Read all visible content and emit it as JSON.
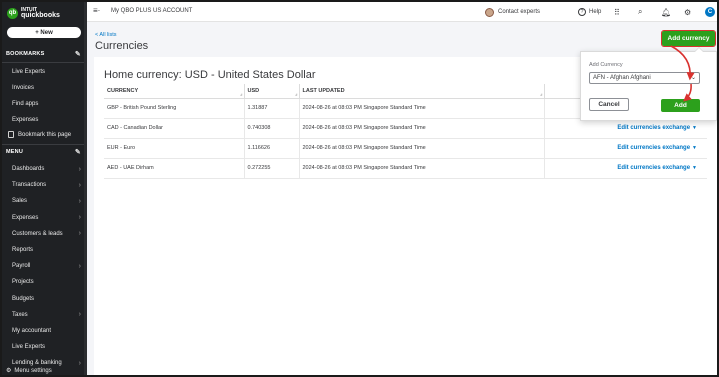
{
  "sidebar": {
    "logo_line1": "INTUIT",
    "logo_line2": "quickbooks",
    "new_label": "+ New",
    "bookmarks_title": "BOOKMARKS",
    "bookmarks": [
      "Live Experts",
      "Invoices",
      "Find apps",
      "Expenses"
    ],
    "bookmark_this_page": "Bookmark this page",
    "menu_title": "MENU",
    "menu_items": [
      {
        "label": "Dashboards",
        "chevron": true
      },
      {
        "label": "Transactions",
        "chevron": true
      },
      {
        "label": "Sales",
        "chevron": true
      },
      {
        "label": "Expenses",
        "chevron": true
      },
      {
        "label": "Customers & leads",
        "chevron": true
      },
      {
        "label": "Reports",
        "chevron": false
      },
      {
        "label": "Payroll",
        "chevron": true
      },
      {
        "label": "Projects",
        "chevron": false
      },
      {
        "label": "Budgets",
        "chevron": false
      },
      {
        "label": "Taxes",
        "chevron": true
      },
      {
        "label": "My accountant",
        "chevron": false
      },
      {
        "label": "Live Experts",
        "chevron": false
      },
      {
        "label": "Lending & banking",
        "chevron": true
      }
    ],
    "menu_settings": "Menu settings"
  },
  "topbar": {
    "company": "My QBO PLUS US ACCOUNT",
    "contact_experts": "Contact experts",
    "help": "Help",
    "user_initial": "C"
  },
  "header": {
    "back_link": "< All lists",
    "title": "Currencies"
  },
  "main": {
    "home_currency": "Home currency: USD - United States Dollar",
    "add_currency_label": "Add currency",
    "table": {
      "headers": [
        "CURRENCY",
        "USD",
        "LAST UPDATED",
        ""
      ],
      "rows": [
        {
          "currency": "GBP - British Pound Sterling",
          "usd": "1.31887",
          "updated": "2024-08-26 at 08:03 PM Singapore Standard Time",
          "action": ""
        },
        {
          "currency": "CAD - Canadian Dollar",
          "usd": "0.740308",
          "updated": "2024-08-26 at 08:03 PM Singapore Standard Time",
          "action": "Edit currencies exchange"
        },
        {
          "currency": "EUR - Euro",
          "usd": "1.116626",
          "updated": "2024-08-26 at 08:03 PM Singapore Standard Time",
          "action": "Edit currencies exchange"
        },
        {
          "currency": "AED - UAE Dirham",
          "usd": "0.272255",
          "updated": "2024-08-26 at 08:03 PM Singapore Standard Time",
          "action": "Edit currencies exchange"
        }
      ]
    }
  },
  "popover": {
    "label": "Add Currency",
    "selected": "AFN - Afghan Afghani",
    "cancel_label": "Cancel",
    "add_label": "Add"
  },
  "colors": {
    "brand_green": "#2ca01c",
    "link_blue": "#0077c5",
    "sidebar_bg": "#1f2124",
    "annotation_red": "#d9322f"
  }
}
